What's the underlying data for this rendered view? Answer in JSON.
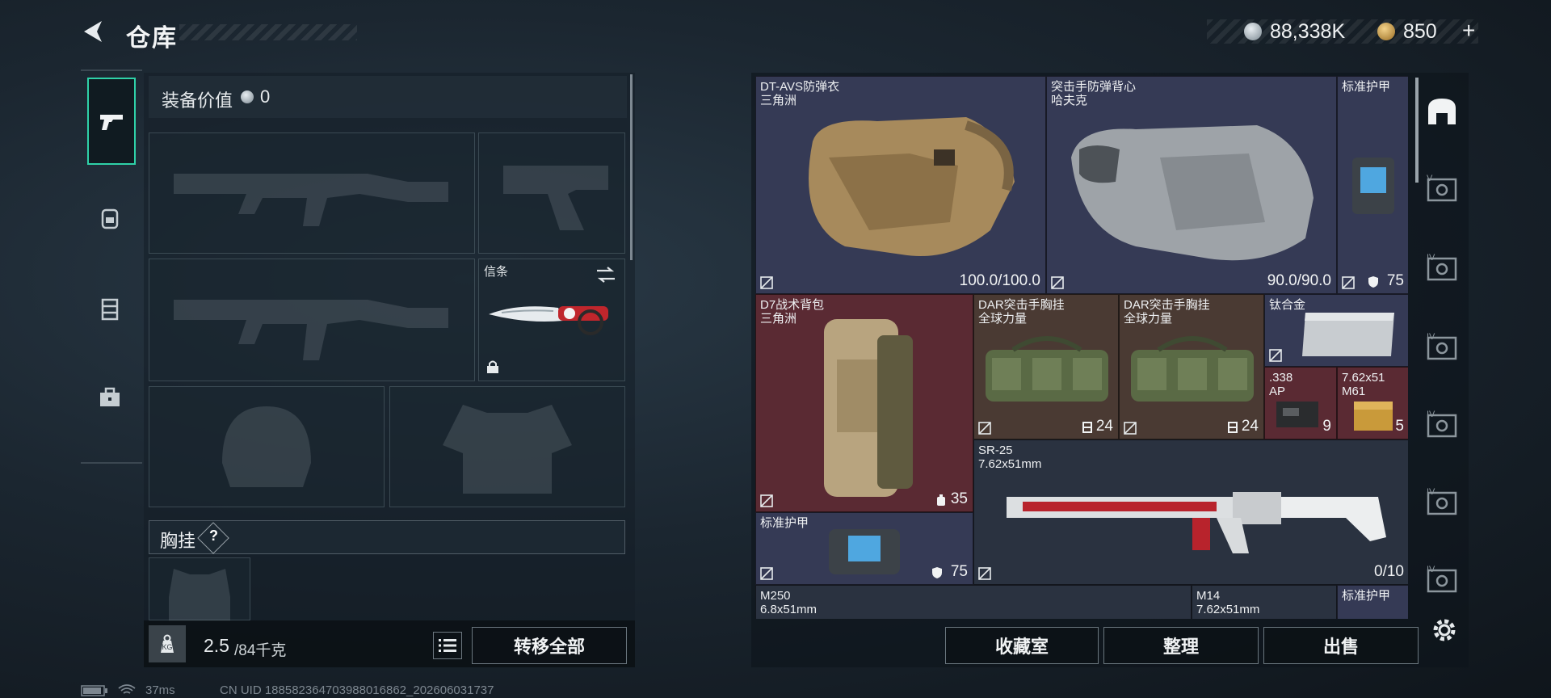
{
  "header": {
    "title": "仓库",
    "currency_silver": "88,338K",
    "currency_gold": "850",
    "currency_plus": "+"
  },
  "tabs": [
    {
      "name": "firearms",
      "active": true
    },
    {
      "name": "backpack",
      "active": false
    },
    {
      "name": "bag",
      "active": false
    },
    {
      "name": "toolbox",
      "active": false
    }
  ],
  "equipment": {
    "label": "装备价值",
    "value": "0",
    "melee_label": "信条",
    "chest_label": "胸挂",
    "help": "?"
  },
  "footer_left": {
    "weight_value": "2.5",
    "weight_max": "/84千克",
    "transfer_all": "转移全部"
  },
  "items": [
    {
      "id": "dt-avs",
      "name": "DT-AVS防弹衣",
      "sub": "三角洲",
      "value": "100.0/100.0"
    },
    {
      "id": "assault-vest",
      "name": "突击手防弹背心",
      "sub": "哈夫克",
      "value": "90.0/90.0"
    },
    {
      "id": "std-armor-1",
      "name": "标准护甲",
      "sub": "",
      "value": "75"
    },
    {
      "id": "d7-backpack",
      "name": "D7战术背包",
      "sub": "三角洲",
      "value": "35"
    },
    {
      "id": "dar-1",
      "name": "DAR突击手胸挂",
      "sub": "全球力量",
      "value": "24"
    },
    {
      "id": "dar-2",
      "name": "DAR突击手胸挂",
      "sub": "全球力量",
      "value": "24"
    },
    {
      "id": "titanium",
      "name": "钛合金",
      "sub": "",
      "value": ""
    },
    {
      "id": "ammo-338",
      "name": ".338",
      "sub": "AP",
      "value": "9"
    },
    {
      "id": "ammo-762",
      "name": "7.62x51",
      "sub": "M61",
      "value": "5"
    },
    {
      "id": "sr25",
      "name": "SR-25",
      "sub": "7.62x51mm",
      "value": "0/10"
    },
    {
      "id": "std-armor-2",
      "name": "标准护甲",
      "sub": "",
      "value": "75"
    },
    {
      "id": "m250",
      "name": "M250",
      "sub": "6.8x51mm",
      "value": ""
    },
    {
      "id": "m14",
      "name": "M14",
      "sub": "7.62x51mm",
      "value": ""
    },
    {
      "id": "std-armor-3",
      "name": "标准护甲",
      "sub": "",
      "value": ""
    }
  ],
  "footer_right": {
    "collection": "收藏室",
    "sort": "整理",
    "sell": "出售"
  },
  "sidebar_levels": [
    "V",
    "IV",
    "IV",
    "IV",
    "IV",
    "IV"
  ],
  "status": {
    "ping": "37ms",
    "uid": "CN UID 18858236470398801686​2_202606031737"
  },
  "colors": {
    "accent": "#2fd1a8",
    "rare_purple": "#353a55",
    "rare_red": "#5a2a33"
  }
}
